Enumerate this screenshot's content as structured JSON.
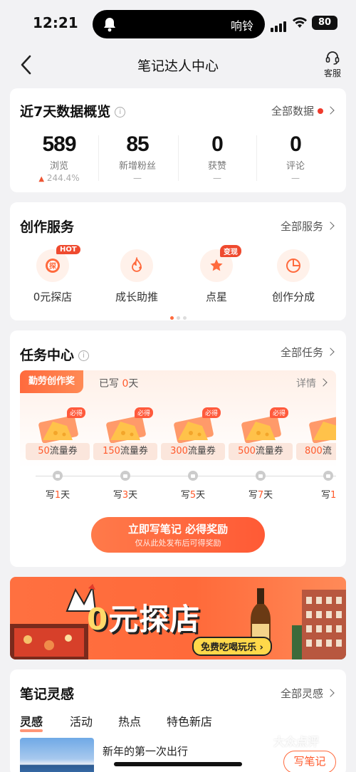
{
  "status_bar": {
    "time": "12:21",
    "ring_mode": "响铃",
    "battery": "80"
  },
  "nav": {
    "title": "笔记达人中心",
    "service_label": "客服"
  },
  "overview": {
    "title": "近7天数据概览",
    "link": "全部数据",
    "stats": [
      {
        "value": "589",
        "label": "浏览",
        "delta": "244.4%"
      },
      {
        "value": "85",
        "label": "新增粉丝",
        "delta": "—"
      },
      {
        "value": "0",
        "label": "获赞",
        "delta": "—"
      },
      {
        "value": "0",
        "label": "评论",
        "delta": "—"
      }
    ]
  },
  "services": {
    "title": "创作服务",
    "link": "全部服务",
    "items": [
      {
        "label": "0元探店",
        "badge": "HOT",
        "icon": "explore-shop-icon"
      },
      {
        "label": "成长助推",
        "badge": "",
        "icon": "flame-boost-icon"
      },
      {
        "label": "点星",
        "badge": "变现",
        "icon": "star-icon"
      },
      {
        "label": "创作分成",
        "badge": "",
        "icon": "pie-chart-icon"
      }
    ]
  },
  "tasks": {
    "title": "任务中心",
    "link": "全部任务",
    "tab": "勤劳创作奖",
    "written_prefix": "已写",
    "written_count": "0",
    "written_suffix": "天",
    "detail": "详情",
    "rewards": [
      {
        "amount": "50",
        "unit": "流量券",
        "badge": "必得"
      },
      {
        "amount": "150",
        "unit": "流量券",
        "badge": "必得"
      },
      {
        "amount": "300",
        "unit": "流量券",
        "badge": "必得"
      },
      {
        "amount": "500",
        "unit": "流量券",
        "badge": "必得"
      },
      {
        "amount": "800",
        "unit": "流",
        "badge": ""
      }
    ],
    "days": [
      {
        "prefix": "写",
        "num": "1",
        "suffix": "天"
      },
      {
        "prefix": "写",
        "num": "3",
        "suffix": "天"
      },
      {
        "prefix": "写",
        "num": "5",
        "suffix": "天"
      },
      {
        "prefix": "写",
        "num": "7",
        "suffix": "天"
      },
      {
        "prefix": "写",
        "num": "1",
        "suffix": ""
      }
    ],
    "cta_main": "立即写笔记 必得奖励",
    "cta_sub": "仅从此处发布后可得奖励"
  },
  "banner": {
    "title_zero": "0",
    "title_rest": "元探店",
    "subtitle": "免费吃喝玩乐 ›"
  },
  "inspiration": {
    "title": "笔记灵感",
    "link": "全部灵感",
    "tabs": [
      "灵感",
      "活动",
      "热点",
      "特色新店"
    ],
    "item_title": "新年的第一次出行",
    "write_button": "写笔记"
  },
  "watermark": "大众点评",
  "colors": {
    "accent": "#ff5a2c",
    "background": "#f2f2f4",
    "card": "#ffffff"
  }
}
